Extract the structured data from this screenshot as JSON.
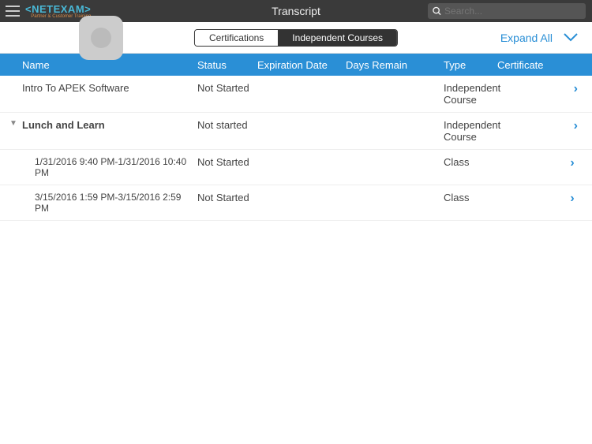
{
  "topbar": {
    "logo_main": "<NETEXAM>",
    "logo_sub": "Partner & Customer Training",
    "title": "Transcript",
    "search_placeholder": "Search..."
  },
  "toolbar": {
    "seg_cert": "Certifications",
    "seg_courses": "Independent Courses",
    "expand_label": "Expand All"
  },
  "columns": {
    "name": "Name",
    "status": "Status",
    "exp": "Expiration Date",
    "days": "Days Remain",
    "type": "Type",
    "cert": "Certificate"
  },
  "rows": [
    {
      "name": "Intro To APEK Software",
      "status": "Not Started",
      "type": "Independent Course"
    },
    {
      "name": "Lunch and Learn",
      "status": "Not started",
      "type": "Independent Course",
      "bold": true,
      "caret": true
    },
    {
      "name": "1/31/2016 9:40 PM-1/31/2016 10:40 PM",
      "status": "Not Started",
      "type": "Class",
      "sub": true
    },
    {
      "name": "3/15/2016 1:59 PM-3/15/2016 2:59 PM",
      "status": "Not Started",
      "type": "Class",
      "sub": true
    }
  ]
}
